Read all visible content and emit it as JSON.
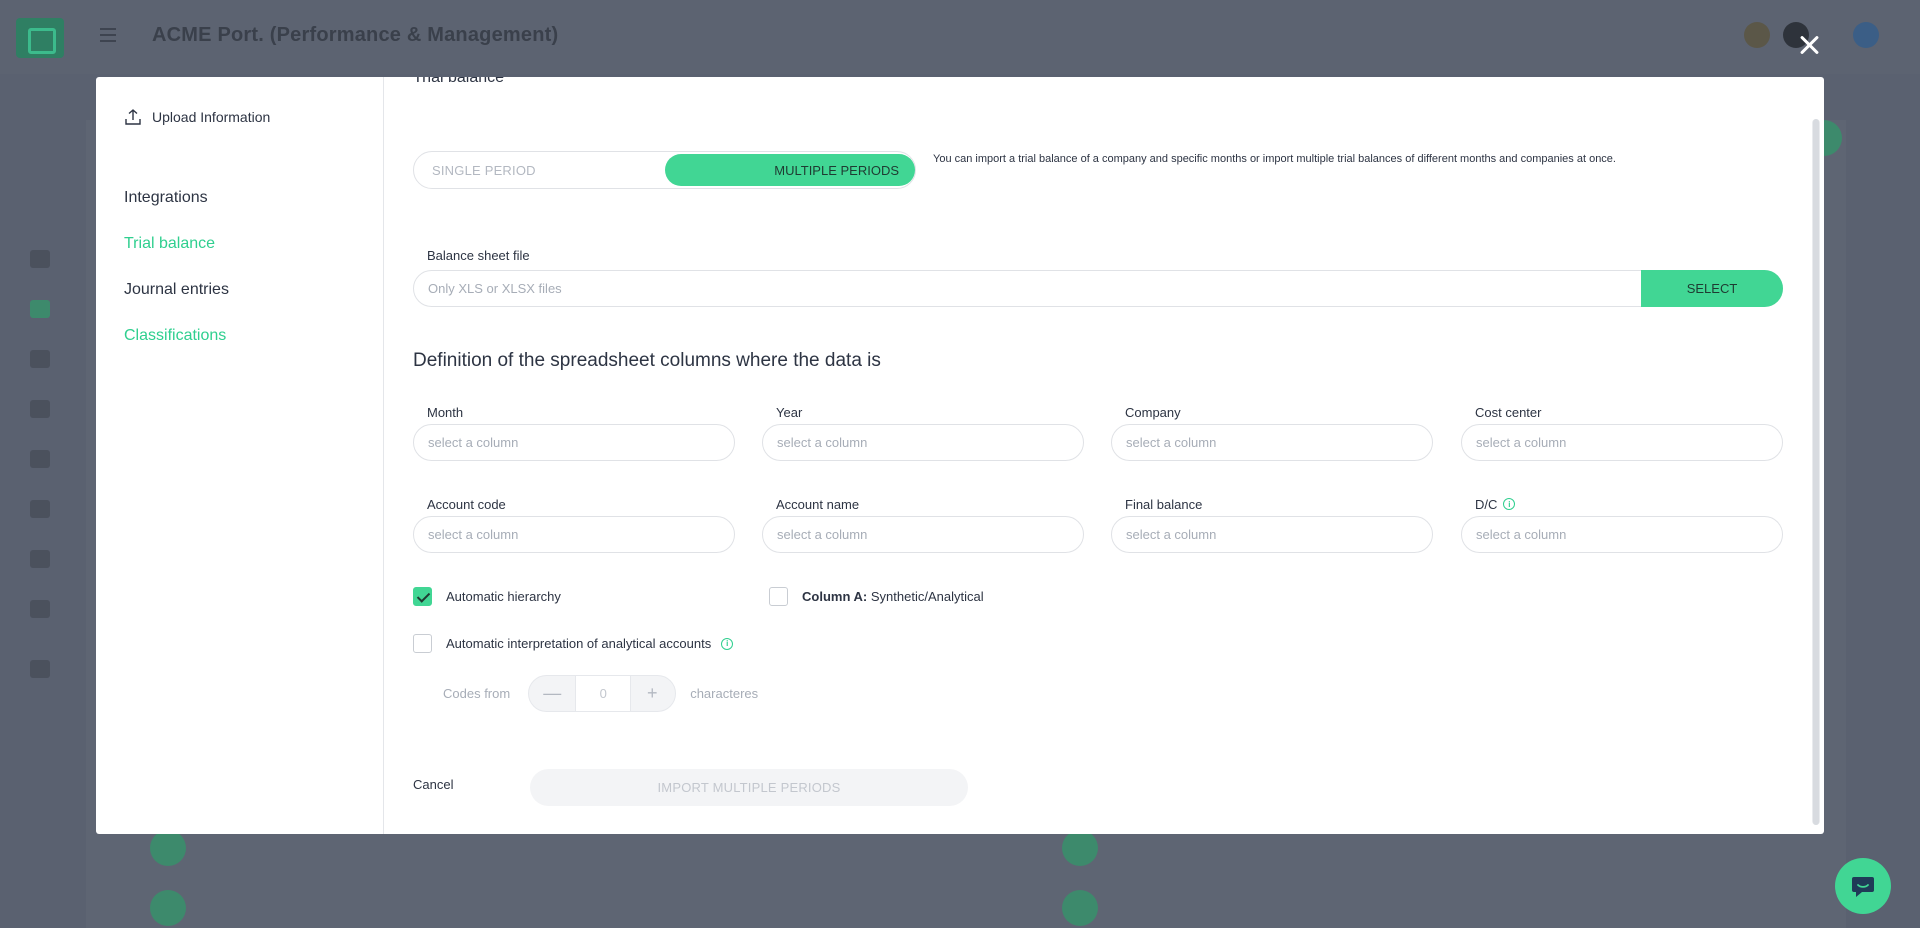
{
  "background": {
    "app_title": "ACME Port. (Performance & Management)"
  },
  "modal": {
    "nav": {
      "upload_label": "Upload Information",
      "items": [
        {
          "label": "Integrations",
          "state": "default"
        },
        {
          "label": "Trial balance",
          "state": "active"
        },
        {
          "label": "Journal entries",
          "state": "default"
        },
        {
          "label": "Classifications",
          "state": "active"
        }
      ]
    },
    "partial_title": "Trial balance",
    "period_toggle": {
      "single_label": "SINGLE PERIOD",
      "multiple_label": "MULTIPLE PERIODS",
      "selected": "multiple",
      "hint": "You can import a trial balance of a company and specific months or import multiple trial balances of different months and companies at once."
    },
    "file": {
      "label": "Balance sheet file",
      "placeholder": "Only XLS or XLSX files",
      "select_label": "SELECT"
    },
    "columns_title": "Definition of the spreadsheet columns where the data is",
    "column_fields": [
      {
        "label": "Month",
        "placeholder": "select a column"
      },
      {
        "label": "Year",
        "placeholder": "select a column"
      },
      {
        "label": "Company",
        "placeholder": "select a column"
      },
      {
        "label": "Cost center",
        "placeholder": "select a column"
      },
      {
        "label": "Account code",
        "placeholder": "select a column"
      },
      {
        "label": "Account name",
        "placeholder": "select a column"
      },
      {
        "label": "Final balance",
        "placeholder": "select a column"
      },
      {
        "label": "D/C",
        "placeholder": "select a column",
        "info": "i"
      }
    ],
    "options": {
      "auto_hierarchy_label": "Automatic hierarchy",
      "auto_hierarchy_checked": true,
      "column_a_bold": "Column A:",
      "column_a_text": "Synthetic/Analytical",
      "column_a_checked": false,
      "auto_interp_label": "Automatic interpretation of analytical accounts",
      "auto_interp_checked": false,
      "auto_interp_info": "i"
    },
    "codes": {
      "prefix": "Codes from",
      "minus": "—",
      "value": "0",
      "plus": "+",
      "suffix": "characteres"
    },
    "footer": {
      "cancel_label": "Cancel",
      "import_label": "IMPORT MULTIPLE PERIODS"
    }
  },
  "colors": {
    "accent": "#41d694",
    "accent_text": "#2fcf8f",
    "overlay": "#4a5260"
  }
}
